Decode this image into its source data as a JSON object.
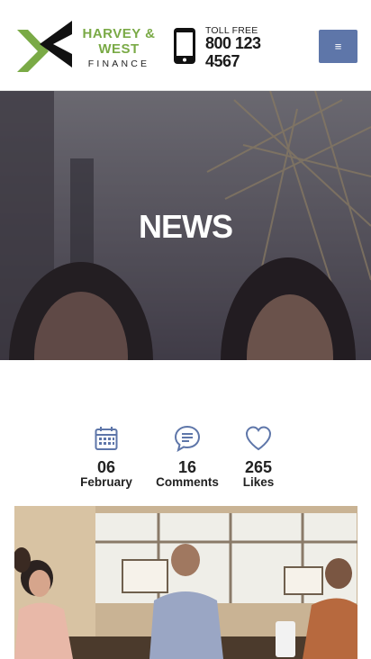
{
  "header": {
    "logo": {
      "line1": "HARVEY &",
      "line2": "WEST",
      "line3": "FINANCE",
      "icon": "chevron-x-logo-icon"
    },
    "phone": {
      "icon": "mobile-phone-icon",
      "label": "TOLL FREE",
      "number": "800 123 4567"
    },
    "menu": {
      "icon": "hamburger-icon",
      "glyph": "≡"
    },
    "colors": {
      "brand_green": "#7aaa46",
      "menu_bg": "#5e76a9"
    }
  },
  "hero": {
    "title": "NEWS"
  },
  "meta": {
    "date": {
      "icon": "calendar-icon",
      "value": "06",
      "label": "February"
    },
    "comments": {
      "icon": "comment-bubble-icon",
      "value": "16",
      "label": "Comments"
    },
    "likes": {
      "icon": "heart-icon",
      "value": "265",
      "label": "Likes"
    },
    "icon_color": "#5e76a9"
  }
}
